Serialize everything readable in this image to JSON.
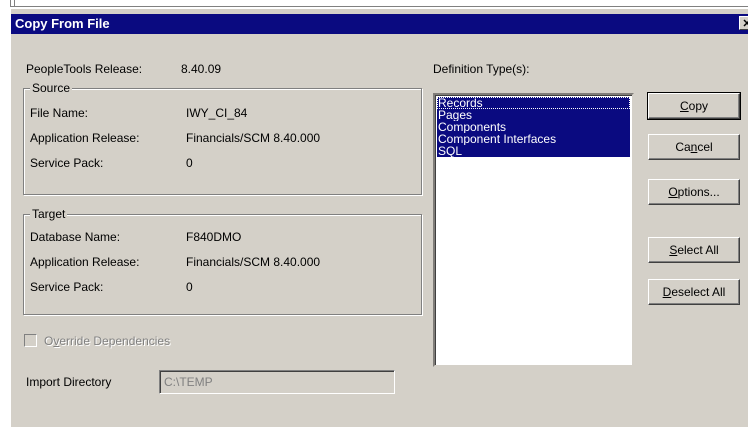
{
  "window": {
    "title": "Copy From File",
    "close_glyph": "✕"
  },
  "peopletools": {
    "label": "PeopleTools Release:",
    "value": "8.40.09"
  },
  "source": {
    "legend": "Source",
    "file_name_label": "File Name:",
    "file_name_value": "IWY_CI_84",
    "app_release_label": "Application Release:",
    "app_release_value": "Financials/SCM 8.40.000",
    "service_pack_label": "Service Pack:",
    "service_pack_value": "0"
  },
  "target": {
    "legend": "Target",
    "db_name_label": "Database Name:",
    "db_name_value": "F840DMO",
    "app_release_label": "Application Release:",
    "app_release_value": "Financials/SCM 8.40.000",
    "service_pack_label": "Service Pack:",
    "service_pack_value": "0"
  },
  "definition_types": {
    "label": "Definition Type(s):",
    "items": [
      "Records",
      "Pages",
      "Components",
      "Component Interfaces",
      "SQL"
    ],
    "selected": [
      true,
      true,
      true,
      true,
      true
    ]
  },
  "buttons": {
    "copy": {
      "pre": "",
      "key": "C",
      "post": "opy"
    },
    "cancel": {
      "pre": "Ca",
      "key": "n",
      "post": "cel"
    },
    "options": {
      "pre": "",
      "key": "O",
      "post": "ptions..."
    },
    "select_all": {
      "pre": "",
      "key": "S",
      "post": "elect All"
    },
    "deselect_all": {
      "pre": "",
      "key": "D",
      "post": "eselect All"
    }
  },
  "override": {
    "pre": "O",
    "key": "v",
    "post": "erride Dependencies",
    "checked": false,
    "enabled": false
  },
  "import_directory": {
    "label": "Import Directory",
    "value": "C:\\TEMP"
  },
  "colors": {
    "face": "#d4d0c8",
    "titlebar": "#0a0a80",
    "selection": "#0a0a80",
    "disabled_text": "#808080"
  }
}
